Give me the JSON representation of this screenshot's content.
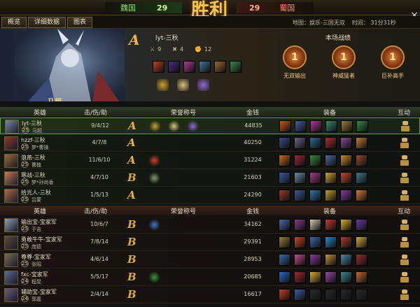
{
  "top": {
    "team_left": "魏国",
    "score_left": "29",
    "victory_text": "胜利",
    "score_right": "29",
    "team_right": "蜀国",
    "close_label": "×"
  },
  "tabs": [
    "概览",
    "详细数据",
    "图表"
  ],
  "map_info": "地图：娱乐-三国无双",
  "time_info": "时间：  31分31秒",
  "hero": {
    "hero_name": "马超",
    "grade": "A",
    "player": "lyt-三秋",
    "kills": "9",
    "deaths": "4",
    "assists": "12",
    "items": [
      {
        "icon": "fire-icon",
        "color": "#c83a1a"
      },
      {
        "icon": "moon-icon",
        "color": "#4a2a8a"
      },
      {
        "icon": "gem-icon",
        "color": "#b03aa0"
      },
      {
        "icon": "sword-icon",
        "color": "#3a7a9a"
      },
      {
        "icon": "boots-icon",
        "color": "#a06a2a"
      },
      {
        "icon": "leaf-icon",
        "color": "#3a8a4a"
      }
    ],
    "honors": [
      {
        "icon": "mvp-icon",
        "color": "#c8a030"
      },
      {
        "icon": "ranged-icon",
        "color": "#d8c080"
      },
      {
        "icon": "flower-icon",
        "color": "#8a6ad8"
      }
    ]
  },
  "performance": {
    "title": "本场战绩",
    "medals": [
      {
        "num": "1",
        "label": "无双输出"
      },
      {
        "num": "1",
        "label": "神威猛者"
      },
      {
        "num": "1",
        "label": "巨补高手"
      }
    ]
  },
  "headers": {
    "hero": "英雄",
    "kda": "击/伤/助",
    "honor": "荣誉称号",
    "gold": "金钱",
    "equip": "装备",
    "interact": "互动"
  },
  "team1": [
    {
      "player": "lyt-三秋",
      "level": "25",
      "hero": "马超",
      "kda": "9/4/12",
      "grade": "A",
      "gold": "44835",
      "selected": true,
      "avatar": "#7a8aa8",
      "honors": [
        "#c8a030",
        "#d8c080",
        "#8a6ad8"
      ],
      "equip": [
        "#c85a1a",
        "#4a5a9a",
        "#b03aa0",
        "#3a8a6a",
        "#a07a3a",
        "#3a8a4a"
      ]
    },
    {
      "player": "hzzf-三秋",
      "level": "25",
      "hero": "梦*曹操",
      "kda": "4/7/8",
      "grade": "A",
      "gold": "40250",
      "selected": false,
      "avatar": "#8a3a2a",
      "honors": [],
      "equip": [
        "#3a4a8a",
        "#6a6a8a",
        "#2a6a9a",
        "#b02a2a",
        "#8a4a9a",
        "#c87a2a"
      ]
    },
    {
      "player": "浪燕-三秋",
      "level": "25",
      "hero": "曹植",
      "kda": "11/6/10",
      "grade": "A",
      "gold": "31224",
      "selected": false,
      "avatar": "#9a6a3a",
      "honors": [
        "#d83a2a"
      ],
      "equip": [
        "#c86a1a",
        "#a02a3a",
        "#3a8a3a",
        "#4a6a9a",
        "#c88a2a",
        "#9a4a2a"
      ]
    },
    {
      "player": "寒战-三秋",
      "level": "25",
      "hero": "梦*孙尚香",
      "kda": "4/7/10",
      "grade": "B",
      "gold": "21603",
      "selected": false,
      "avatar": "#c87a5a",
      "honors": [
        "#7a9a6a"
      ],
      "equip": [
        "#3a5aa8",
        "#6a8aa8",
        "#b03a8a",
        "#d8a02a",
        "#c84a2a",
        "#3a7a8a"
      ]
    },
    {
      "player": "拾光人-三秋",
      "level": "25",
      "hero": "吕蒙",
      "kda": "1/5/13",
      "grade": "A",
      "gold": "24290",
      "selected": false,
      "avatar": "#b06a4a",
      "honors": [],
      "equip": [
        "#a03a2a",
        "#3a5a9a",
        "#2a7ab0",
        "#c8a02a",
        "#8a3aa0",
        "#d87a2a"
      ]
    }
  ],
  "team2": [
    {
      "player": "输出宝-宝家军",
      "level": "25",
      "hero": "于吉",
      "kda": "10/6/7",
      "grade": "B",
      "gold": "34162",
      "avatar": "#8aa0b8",
      "honors": [
        "#3a7ac8"
      ],
      "equip": [
        "#4a6ab0",
        "#8a3a8a",
        "#d8d0b0",
        "#c83a2a",
        "#d8b02a",
        "#6a3aa8"
      ]
    },
    {
      "player": "勇敢牛牛-宝家军",
      "level": "25",
      "hero": "庞德",
      "kda": "7/8/14",
      "grade": "B",
      "gold": "29391",
      "avatar": "#5a4a3a",
      "honors": [],
      "equip": [
        "#a07a3a",
        "#c84a1a",
        "#3a6ab0",
        "#2a8ac8",
        "#b03a2a",
        "#d8a83a"
      ]
    },
    {
      "player": "尊尊-宝家军",
      "level": "25",
      "hero": "张昭",
      "kda": "4/6/14",
      "grade": "B",
      "gold": "28953",
      "avatar": "#7a6a5a",
      "honors": [],
      "equip": [
        "#3a6ab0",
        "#c84a8a",
        "#8a3aa0",
        "#c8903a",
        "#4a8aa8",
        "#a02a2a"
      ]
    },
    {
      "player": "fxc-宝家军",
      "level": "24",
      "hero": "程昱",
      "kda": "5/5/17",
      "grade": "B",
      "gold": "20685",
      "avatar": "#5a6a8a",
      "honors": [
        "#3a9a3a"
      ],
      "equip": [
        "#2a6ac8",
        "#a02a2a",
        "#d8b02a",
        "#9a4aa0",
        "#3a8a8a",
        "#c86a2a"
      ]
    },
    {
      "player": "辅助宝-宝家军",
      "level": "24",
      "hero": "郭嘉",
      "kda": "2/4/14",
      "grade": "B",
      "gold": "16617",
      "avatar": "#6a5a7a",
      "honors": [],
      "equip": [
        "#c83a2a",
        "#3a5aa8",
        "#2a2a2a",
        "#2a2a2a",
        "#2a2a2a",
        "#2a2a2a"
      ]
    }
  ]
}
